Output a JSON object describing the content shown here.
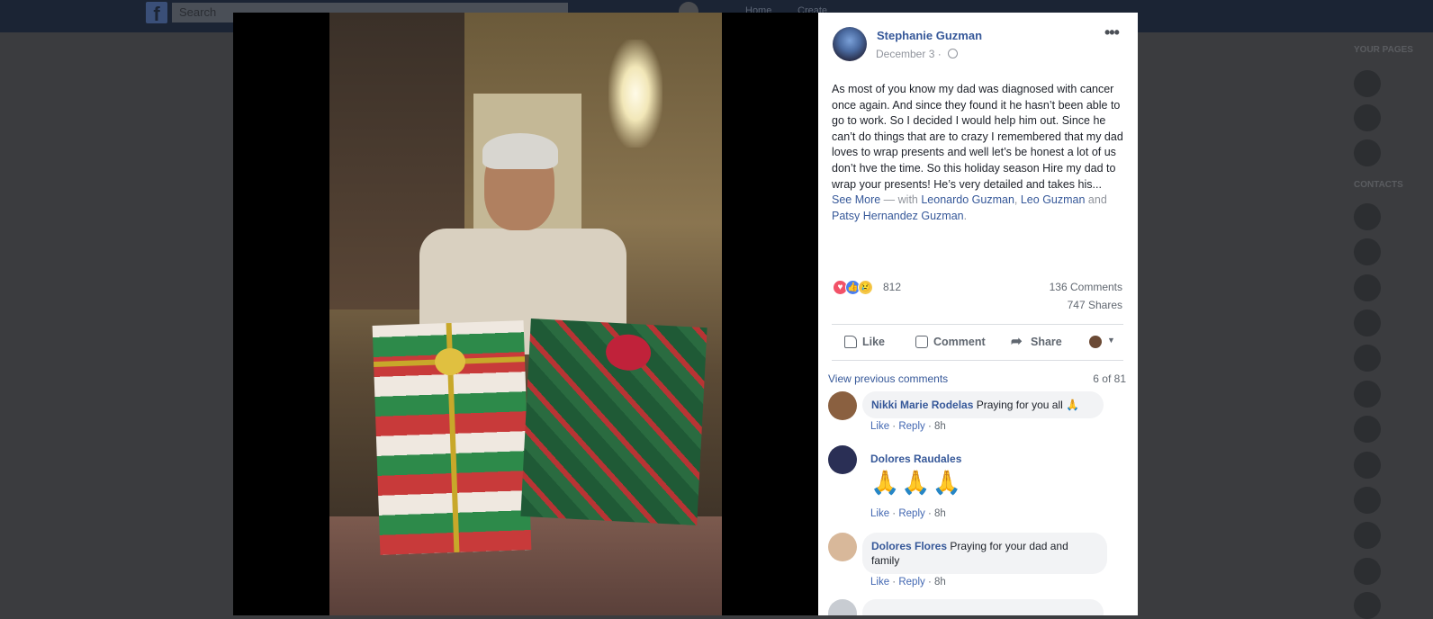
{
  "background": {
    "search_placeholder": "Search",
    "nav": [
      "Home",
      "Create"
    ],
    "right_section": "YOUR PAGES",
    "contacts_section": "CONTACTS"
  },
  "post": {
    "author": "Stephanie Guzman",
    "date": "December 3",
    "text": "As most of you know my dad was diagnosed with cancer once again. And since they found it he hasn’t been able to go to work. So I decided I would help him out. Since he can’t do things that are to crazy I remembered that my dad loves to wrap presents and well let’s be honest a lot of us don’t hve the time. So this holiday season Hire my dad to wrap your presents! He’s very detailed and takes his...",
    "see_more": "See More",
    "with_prefix": " — with ",
    "tag1": "Leonardo Guzman",
    "comma": ", ",
    "tag2": "Leo Guzman",
    "and": " and ",
    "tag3": "Patsy Hernandez Guzman",
    "period": "."
  },
  "stats": {
    "reactions_count": "812",
    "comments": "136 Comments",
    "shares": "747 Shares"
  },
  "actions": {
    "like": "Like",
    "comment": "Comment",
    "share": "Share"
  },
  "comments_section": {
    "view_previous": "View previous comments",
    "count": "6 of 81",
    "like": "Like",
    "reply": "Reply",
    "sep": " · ",
    "items": [
      {
        "name": "Nikki Marie Rodelas",
        "text": " Praying for you all 🙏",
        "time": "8h"
      },
      {
        "name": "Dolores Raudales",
        "text": "🙏🙏🙏",
        "time": "8h"
      },
      {
        "name": "Dolores Flores",
        "text": " Praying for your dad and family",
        "time": "8h"
      }
    ]
  },
  "colors": {
    "link": "#365899",
    "meta": "#90949c",
    "backdrop": "#3b3c3f"
  }
}
